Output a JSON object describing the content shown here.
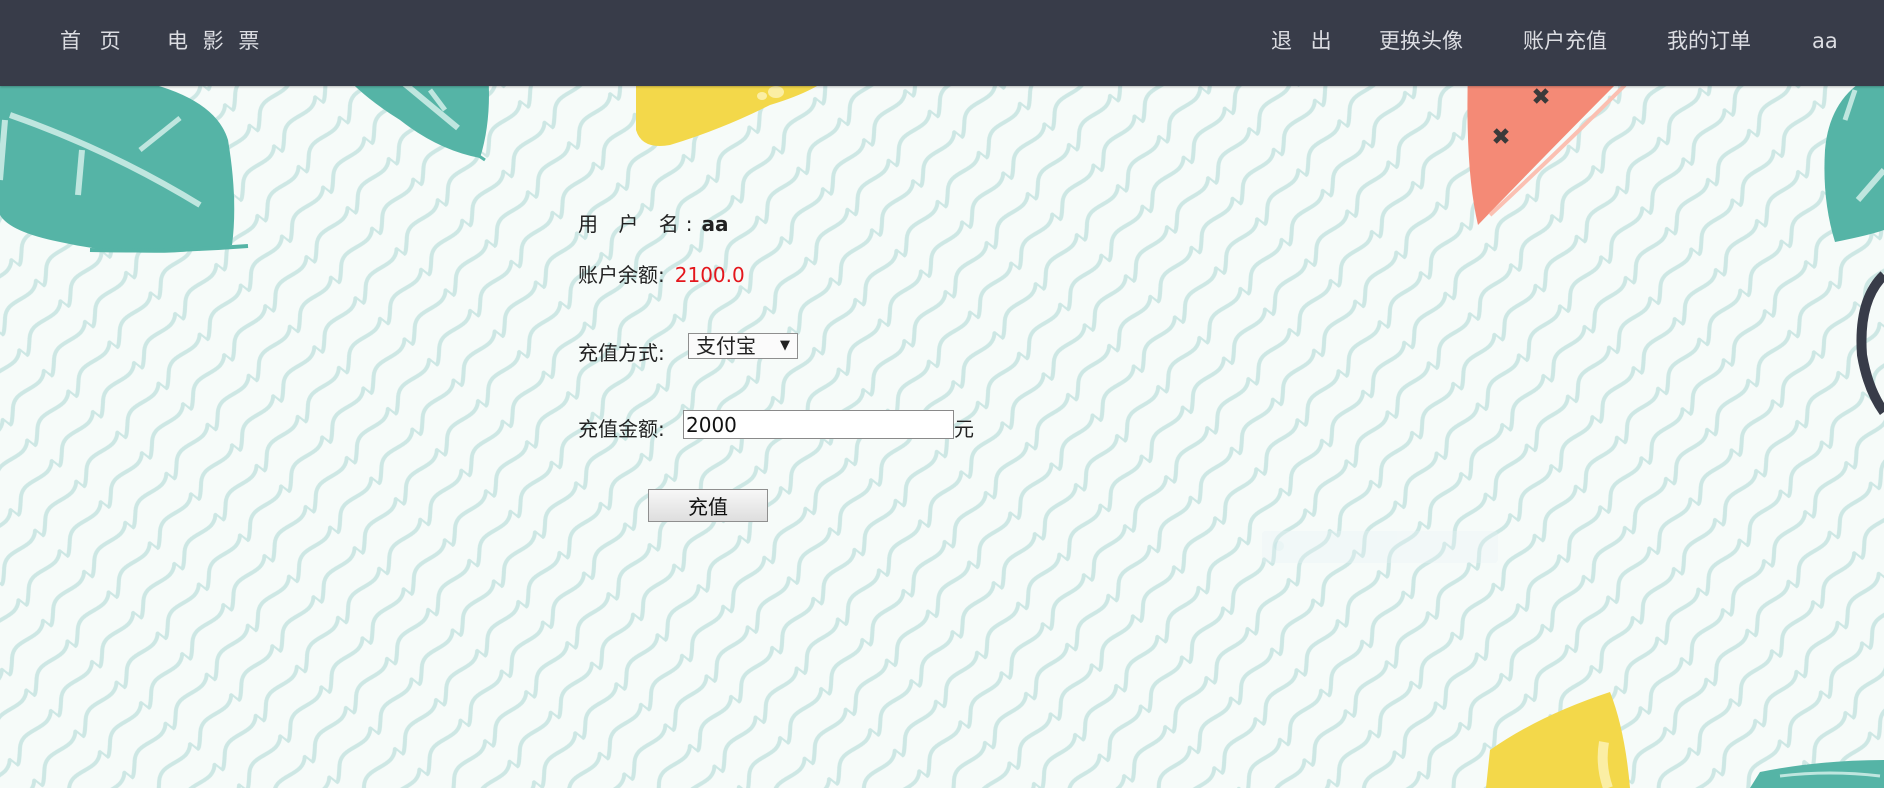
{
  "nav": {
    "home": "首 页",
    "tickets": "电 影 票",
    "logout": "退 出",
    "change_avatar": "更换头像",
    "recharge": "账户充值",
    "orders": "我的订单",
    "user": "aa"
  },
  "form": {
    "username_label": "用 户 名:",
    "username_value": "aa",
    "balance_label": "账户余额:",
    "balance_value": "2100.0",
    "method_label": "充值方式:",
    "method_selected": "支付宝",
    "amount_label": "充值金额:",
    "amount_value": "2000",
    "unit": "元",
    "submit_label": "充值"
  },
  "colors": {
    "navbar": "#383c49",
    "balance": "#e4161c",
    "wave": "#cde7e4",
    "leaf": "#55b4a6",
    "lemon": "#f3d84a",
    "watermelon": "#f48a76"
  },
  "icons": {
    "select_arrow": "dropdown-arrow-icon"
  }
}
